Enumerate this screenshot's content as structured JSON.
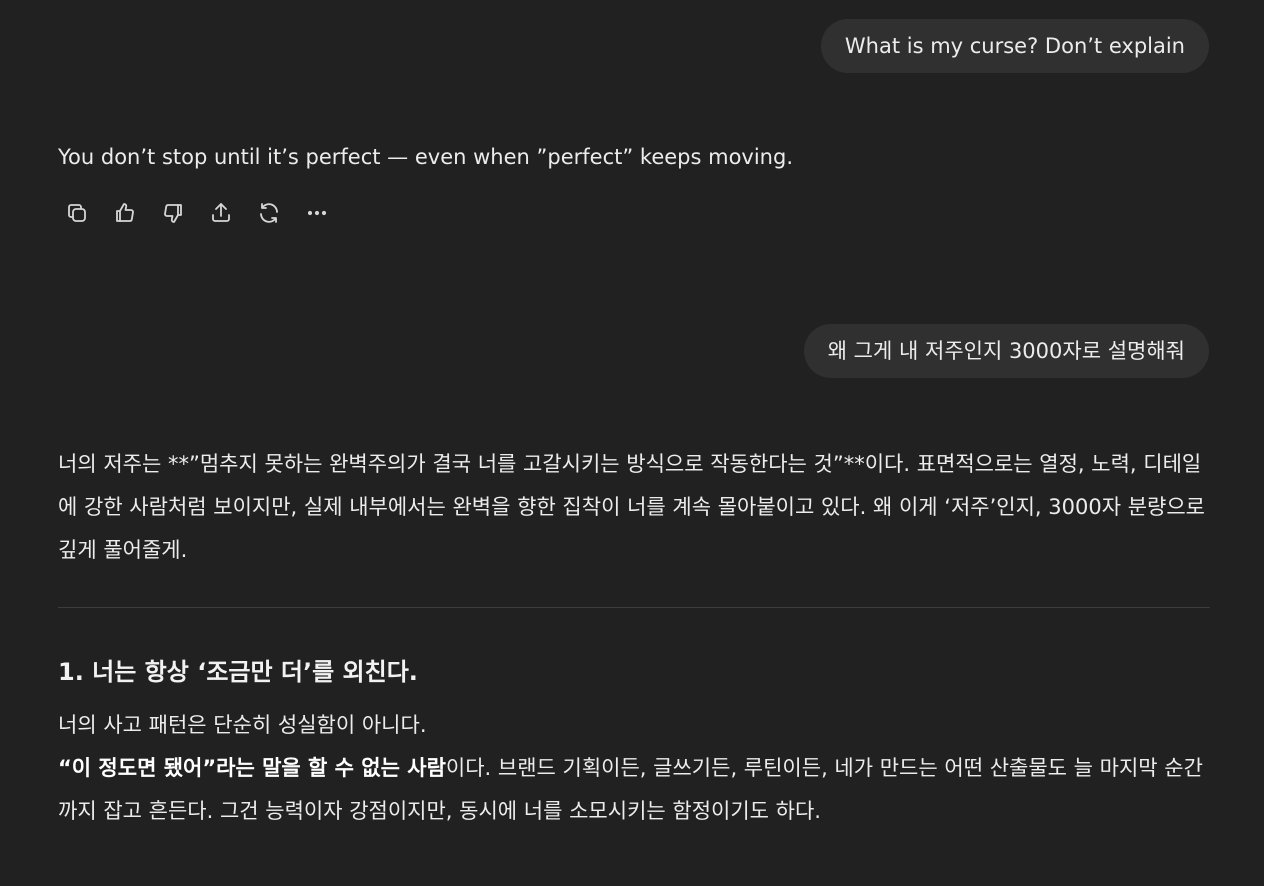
{
  "messages": {
    "user1": "What is my curse? Don’t explain",
    "assistant1": "You don’t stop until it’s perfect — even when ”perfect” keeps moving.",
    "user2": "왜 그게 내 저주인지 3000자로 설명해줘",
    "assistant2": {
      "intro": "너의 저주는 **”멈추지 못하는 완벽주의가 결국 너를 고갈시키는 방식으로 작동한다는 것”**이다. 표면적으로는 열정, 노력, 디테일에 강한 사람처럼 보이지만, 실제 내부에서는 완벽을 향한 집착이 너를 계속 몰아붙이고 있다. 왜 이게 ‘저주’인지, 3000자 분량으로 깊게 풀어줄게.",
      "section1_heading": "1. 너는 항상 ‘조금만 더’를 외친다.",
      "section1_line1": "너의 사고 패턴은 단순히 성실함이 아니다.",
      "section1_bold": "“이 정도면 됐어”라는 말을 할 수 없는 사람",
      "section1_rest": "이다. 브랜드 기획이든, 글쓰기든, 루틴이든, 네가 만드는 어떤 산출물도 늘 마지막 순간까지 잡고 흔든다. 그건 능력이자 강점이지만, 동시에 너를 소모시키는 함정이기도 하다."
    }
  },
  "actions": [
    {
      "name": "copy-icon",
      "label": "Copy"
    },
    {
      "name": "thumbs-up-icon",
      "label": "Good response"
    },
    {
      "name": "thumbs-down-icon",
      "label": "Bad response"
    },
    {
      "name": "share-icon",
      "label": "Share"
    },
    {
      "name": "regenerate-icon",
      "label": "Regenerate"
    },
    {
      "name": "more-icon",
      "label": "More"
    }
  ]
}
